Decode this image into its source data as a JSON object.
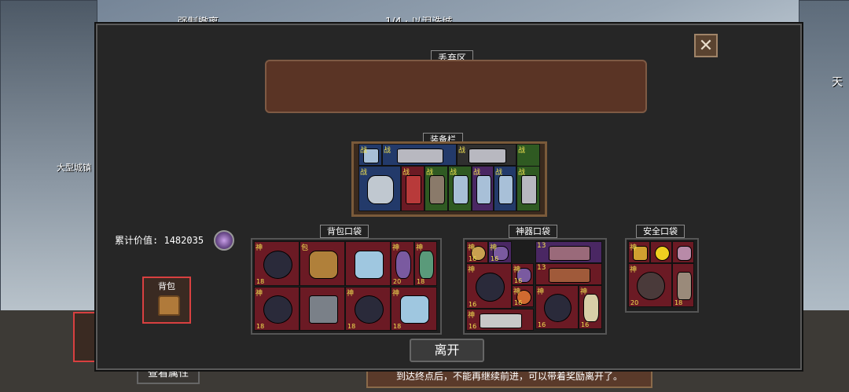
{
  "background": {
    "town_label": "大型城镇",
    "side_label": "天",
    "top_title": "1/4 · 以泪洗城",
    "top_left": "强制撤离"
  },
  "discard_zone": {
    "label": "丢弃区"
  },
  "equipment_bar": {
    "label": "装备栏",
    "slots": [
      {
        "tag": "战",
        "color": "blue",
        "icon": "axe-icon"
      },
      {
        "tag": "战",
        "color": "blue",
        "icon": "spear-icon"
      },
      {
        "tag": "战",
        "color": "dark",
        "icon": "spear-icon"
      },
      {
        "tag": "战",
        "color": "green",
        "icon": "empty"
      },
      {
        "tag": "战",
        "color": "blue",
        "icon": "battle-axe-icon"
      },
      {
        "tag": "战",
        "color": "red",
        "icon": "sword-icon"
      },
      {
        "tag": "战",
        "color": "green",
        "icon": "hammer-icon"
      },
      {
        "tag": "战",
        "color": "green",
        "icon": "axe-icon"
      },
      {
        "tag": "战",
        "color": "purple",
        "icon": "axe-icon"
      },
      {
        "tag": "战",
        "color": "blue",
        "icon": "axe-icon"
      },
      {
        "tag": "战",
        "color": "green",
        "icon": "spear-icon"
      }
    ]
  },
  "total_value": {
    "label": "累计价值:",
    "value": "1482035",
    "icon": "coin-icon"
  },
  "backpack_pouch": {
    "label": "背包口袋",
    "cells": [
      {
        "tag": "神",
        "num": "18",
        "icon": "demon-mask-icon"
      },
      {
        "tag": "包",
        "num": "",
        "icon": "backpack-icon"
      },
      {
        "tag": "",
        "num": "",
        "icon": "ice-totem-icon"
      },
      {
        "tag": "神",
        "num": "20",
        "icon": "scarab-icon"
      },
      {
        "tag": "神",
        "num": "18",
        "icon": "potion-icon"
      },
      {
        "tag": "神",
        "num": "18",
        "icon": "demon-mask-icon"
      },
      {
        "tag": "",
        "num": "",
        "icon": "stone-tablet-icon"
      },
      {
        "tag": "神",
        "num": "18",
        "icon": "demon-mask-icon"
      },
      {
        "tag": "神",
        "num": "18",
        "icon": "ice-totem-icon"
      }
    ]
  },
  "artifact_pouch": {
    "label": "神器口袋",
    "cells": [
      {
        "tag": "神",
        "num": "16",
        "icon": "lion-coin-icon"
      },
      {
        "tag": "神",
        "num": "16",
        "icon": "scarab-icon"
      },
      {
        "tag": "神",
        "num": "16",
        "icon": "scarab-icon"
      },
      {
        "tag": "13",
        "num": "",
        "icon": "flute-icon"
      },
      {
        "tag": "13",
        "num": "",
        "icon": "chain-icon"
      },
      {
        "tag": "神",
        "num": "16",
        "icon": "demon-mask-icon"
      },
      {
        "tag": "神",
        "num": "16",
        "icon": "orb-icon"
      },
      {
        "tag": "神",
        "num": "16",
        "icon": "demon-mask-icon"
      },
      {
        "tag": "神",
        "num": "16",
        "icon": "skull-doll-icon"
      },
      {
        "tag": "神",
        "num": "16",
        "icon": "drill-icon"
      }
    ]
  },
  "safe_pouch": {
    "label": "安全口袋",
    "cells": [
      {
        "tag": "神",
        "num": "",
        "icon": "key-icon"
      },
      {
        "tag": "",
        "num": "",
        "icon": "star-icon"
      },
      {
        "tag": "",
        "num": "",
        "icon": "skull-key-icon"
      },
      {
        "tag": "神",
        "num": "20",
        "icon": "spider-icon"
      },
      {
        "tag": "",
        "num": "18",
        "icon": "claw-icon"
      }
    ]
  },
  "buttons": {
    "backpack": "背包",
    "leave": "离开",
    "view_attributes": "查看属性",
    "close": "✕"
  },
  "bottom_hint": "到达终点后，不能再继续前进，可以带着奖励离开了。"
}
